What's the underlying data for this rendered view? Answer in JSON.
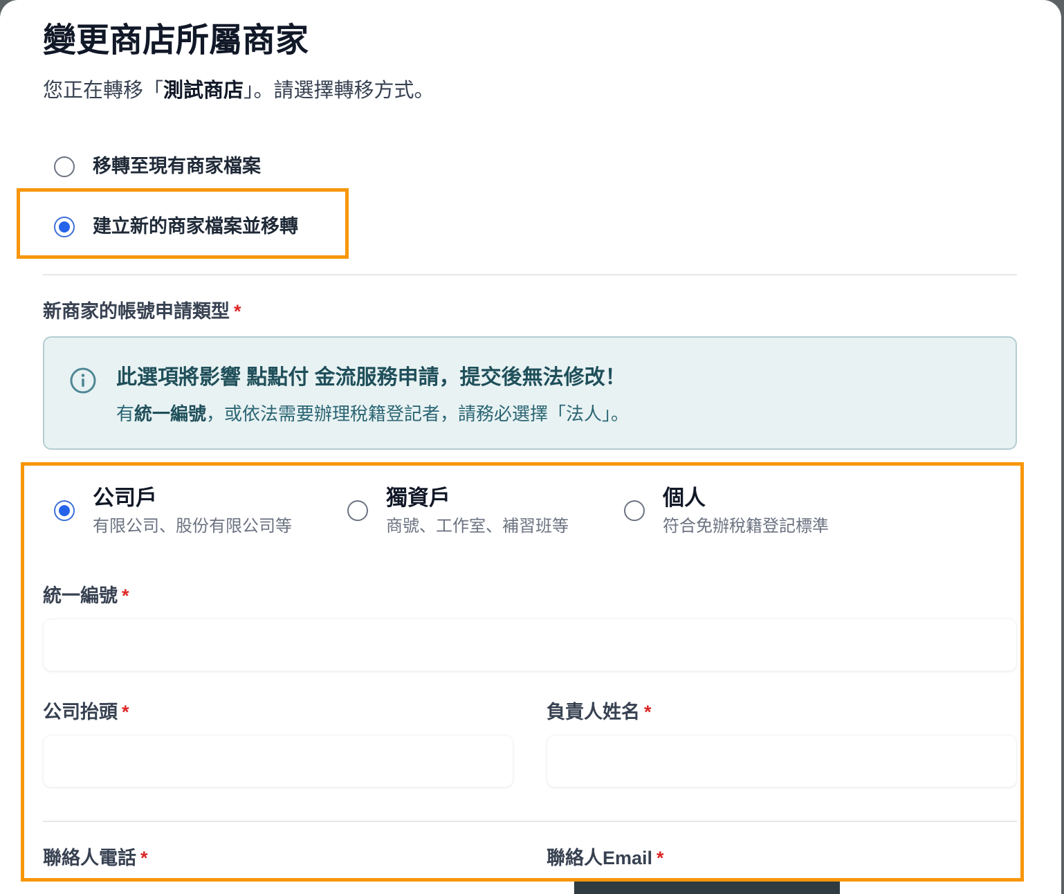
{
  "dialog": {
    "title": "變更商店所屬商家",
    "subtitle_prefix": "您正在轉移「",
    "store_name": "測試商店",
    "subtitle_suffix": "」。請選擇轉移方式。"
  },
  "transfer_options": [
    {
      "label": "移轉至現有商家檔案",
      "checked": false
    },
    {
      "label": "建立新的商家檔案並移轉",
      "checked": true
    }
  ],
  "account_type": {
    "label": "新商家的帳號申請類型",
    "required_mark": "*"
  },
  "notice": {
    "title": "此選項將影響 點點付 金流服務申請，提交後無法修改！",
    "body_prefix": "有",
    "body_bold": "統一編號",
    "body_suffix": "，或依法需要辦理稅籍登記者，請務必選擇「法人」。",
    "icon": "info-icon"
  },
  "account_types": [
    {
      "title": "公司戶",
      "desc": "有限公司、股份有限公司等",
      "checked": true
    },
    {
      "title": "獨資戶",
      "desc": "商號、工作室、補習班等",
      "checked": false
    },
    {
      "title": "個人",
      "desc": "符合免辦稅籍登記標準",
      "checked": false
    }
  ],
  "fields": {
    "tax_id": {
      "label": "統一編號",
      "required_mark": "*",
      "value": ""
    },
    "company_name": {
      "label": "公司抬頭",
      "required_mark": "*",
      "value": ""
    },
    "owner_name": {
      "label": "負責人姓名",
      "required_mark": "*",
      "value": ""
    },
    "contact_phone": {
      "label": "聯絡人電話",
      "required_mark": "*"
    },
    "contact_email": {
      "label": "聯絡人Email",
      "required_mark": "*"
    }
  },
  "colors": {
    "highlight": "#f7960b",
    "radio_checked": "#2563eb",
    "required": "#dc2626",
    "notice_bg": "#e8f2f3"
  }
}
